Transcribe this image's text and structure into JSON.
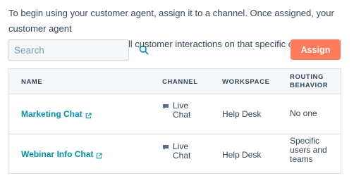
{
  "intro": {
    "line1": "To begin using your customer agent, assign it to a channel. Once assigned, your customer agent",
    "line2": "will manage and respond to all customer interactions on that specific channel."
  },
  "search": {
    "placeholder": "Search",
    "icon": "search-icon"
  },
  "assign_button": {
    "label": "Assign",
    "color": "#ff7a59"
  },
  "table": {
    "headers": {
      "name": "NAME",
      "channel": "CHANNEL",
      "workspace": "WORKSPACE",
      "routing_line1": "ROUTING",
      "routing_line2": "BEHAVIOR"
    },
    "rows": [
      {
        "name": "Marketing Chat",
        "channel_line1": "Live",
        "channel_line2": "Chat",
        "workspace": "Help Desk",
        "routing_line1": "No one"
      },
      {
        "name": "Webinar Info Chat",
        "channel_line1": "Live",
        "channel_line2": "Chat",
        "workspace": "Help Desk",
        "routing_line1": "Specific",
        "routing_line2": "users and",
        "routing_line3": "teams"
      }
    ]
  },
  "colors": {
    "link": "#0091ae",
    "text": "#33475b",
    "header_bg": "#f5f8fa",
    "border": "#dfe3eb"
  }
}
